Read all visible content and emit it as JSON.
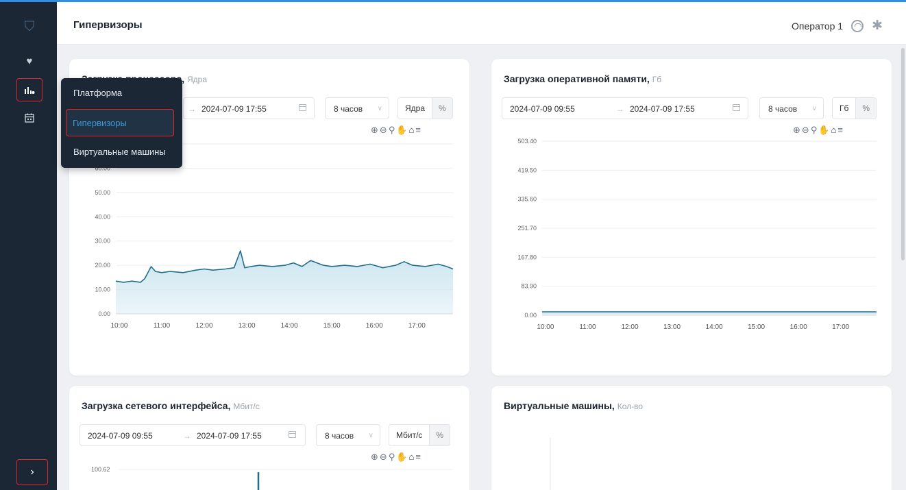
{
  "header": {
    "title": "Гипервизоры",
    "user": "Оператор 1"
  },
  "menu": {
    "items": [
      "Платформа",
      "Гипервизоры",
      "Виртуальные машины"
    ],
    "active": "Гипервизоры"
  },
  "cards": {
    "cpu": {
      "title": "Загрузка процессора,",
      "unit": "Ядра",
      "range_end": "2024-07-09 17:55",
      "period": "8 часов",
      "unit_options": [
        "Ядра",
        "%"
      ]
    },
    "memory": {
      "title": "Загрузка оперативной памяти,",
      "unit": "Гб",
      "range_start": "2024-07-09 09:55",
      "range_end": "2024-07-09 17:55",
      "period": "8 часов",
      "unit_options": [
        "Гб",
        "%"
      ]
    },
    "network": {
      "title": "Загрузка сетевого интерфейса,",
      "unit": "Мбит/с",
      "range_start": "2024-07-09 09:55",
      "range_end": "2024-07-09 17:55",
      "period": "8 часов",
      "unit_options": [
        "Мбит/с",
        "%"
      ]
    },
    "vms": {
      "title": "Виртуальные машины,",
      "unit": "Кол-во"
    }
  },
  "colors": {
    "sidebar": "#1b2735",
    "series_line": "#1f6f8b",
    "series_fill": "#c8e3ee",
    "highlight": "#e0282a",
    "accent": "#3d9ad9"
  },
  "chart_data": [
    {
      "type": "area",
      "ylabel": "Ядра",
      "x_ticks": [
        "10:00",
        "11:00",
        "12:00",
        "13:00",
        "14:00",
        "15:00",
        "16:00",
        "17:00"
      ],
      "y_ticks": [
        "0.00",
        "10.00",
        "20.00",
        "30.00",
        "40.00",
        "50.00",
        "60.00"
      ],
      "ylim": [
        0,
        70
      ],
      "x": [
        9.92,
        10.1,
        10.3,
        10.5,
        10.6,
        10.75,
        10.85,
        11.0,
        11.2,
        11.5,
        11.8,
        12.0,
        12.2,
        12.5,
        12.7,
        12.85,
        12.95,
        13.1,
        13.3,
        13.6,
        13.9,
        14.1,
        14.3,
        14.5,
        14.8,
        15.0,
        15.3,
        15.6,
        15.9,
        16.2,
        16.5,
        16.7,
        16.9,
        17.2,
        17.5,
        17.7,
        17.85
      ],
      "y": [
        13.5,
        13.0,
        13.5,
        13.0,
        14.5,
        19.5,
        17.5,
        17.0,
        17.5,
        17.0,
        18.0,
        18.5,
        18.0,
        18.5,
        19.0,
        26.0,
        19.0,
        19.5,
        20.0,
        19.5,
        20.0,
        21.0,
        19.5,
        22.0,
        20.0,
        19.5,
        20.0,
        19.5,
        20.5,
        19.0,
        20.0,
        21.5,
        20.0,
        19.5,
        20.5,
        19.5,
        18.5
      ]
    },
    {
      "type": "area",
      "ylabel": "Гб",
      "x_ticks": [
        "10:00",
        "11:00",
        "12:00",
        "13:00",
        "14:00",
        "15:00",
        "16:00",
        "17:00"
      ],
      "y_ticks": [
        "0.00",
        "83.90",
        "167.80",
        "251.70",
        "335.60",
        "419.50",
        "503.40"
      ],
      "ylim": [
        0,
        503.4
      ],
      "x": [
        9.92,
        17.85
      ],
      "y": [
        10.0,
        10.0
      ]
    },
    {
      "type": "line",
      "ylabel": "Мбит/с",
      "y_ticks": [
        "100.62"
      ],
      "x": [],
      "y": []
    }
  ]
}
